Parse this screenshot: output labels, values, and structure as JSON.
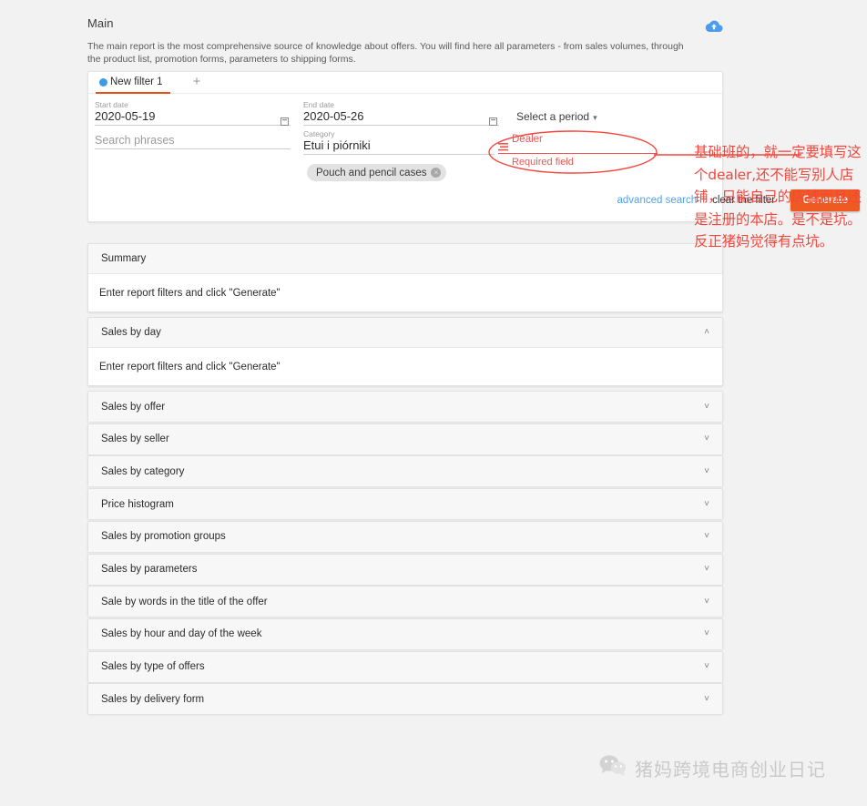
{
  "header": {
    "title": "Main",
    "cloud_icon": "cloud-upload-icon",
    "description": "The main report is the most comprehensive source of knowledge about offers. You will find here all parameters - from sales volumes, through the product list, promotion forms, parameters to shipping forms."
  },
  "filter_card": {
    "tab": {
      "label": "New filter 1",
      "dot_color": "#3d9ae8",
      "underline_color": "#e8500f"
    },
    "add_tab_label": "+",
    "fields": {
      "start_date": {
        "label": "Start date",
        "value": "2020-05-19",
        "icon": "calendar-icon"
      },
      "end_date": {
        "label": "End date",
        "value": "2020-05-26",
        "icon": "calendar-icon"
      },
      "search_phrases": {
        "placeholder": "Search phrases",
        "value": ""
      },
      "category": {
        "label": "Category",
        "value": "Etui i piórniki",
        "chip": "Pouch and pencil cases",
        "chip_remove": "×"
      },
      "dealer": {
        "label": "Dealer",
        "error": "Required field",
        "icon": "list-icon"
      }
    },
    "period_select": {
      "label": "Select a period",
      "caret": "▾"
    },
    "actions": {
      "advanced_search": "advanced search",
      "clear_filter": "clear the filter",
      "generate": "Generate",
      "generate_color": "#ef5a22"
    }
  },
  "accordions": [
    {
      "title": "Summary",
      "body": "Enter report filters and click \"Generate\"",
      "expanded": true,
      "caret": ""
    },
    {
      "title": "Sales by day",
      "body": "Enter report filters and click \"Generate\"",
      "expanded": true,
      "caret": "˄"
    },
    {
      "title": "Sales by offer",
      "expanded": false,
      "caret": "˅"
    },
    {
      "title": "Sales by seller",
      "expanded": false,
      "caret": "˅"
    },
    {
      "title": "Sales by category",
      "expanded": false,
      "caret": "˅"
    },
    {
      "title": "Price histogram",
      "expanded": false,
      "caret": "˅"
    },
    {
      "title": "Sales by promotion groups",
      "expanded": false,
      "caret": "˅"
    },
    {
      "title": "Sales by parameters",
      "expanded": false,
      "caret": "˅"
    },
    {
      "title": "Sale by words in the title of the offer",
      "expanded": false,
      "caret": "˅"
    },
    {
      "title": "Sales by hour and day of the week",
      "expanded": false,
      "caret": "˅"
    },
    {
      "title": "Sales by type of offers",
      "expanded": false,
      "caret": "˅"
    },
    {
      "title": "Sales by delivery form",
      "expanded": false,
      "caret": "˅"
    }
  ],
  "annotation": {
    "color": "#f4463c",
    "text": "基础班的，就一定要填写这个dealer,还不能写别人店铺，只能自己的店铺而且还是注册的本店。是不是坑。反正猪妈觉得有点坑。"
  },
  "watermark": {
    "icon": "wechat-icon",
    "text": "猪妈跨境电商创业日记"
  }
}
